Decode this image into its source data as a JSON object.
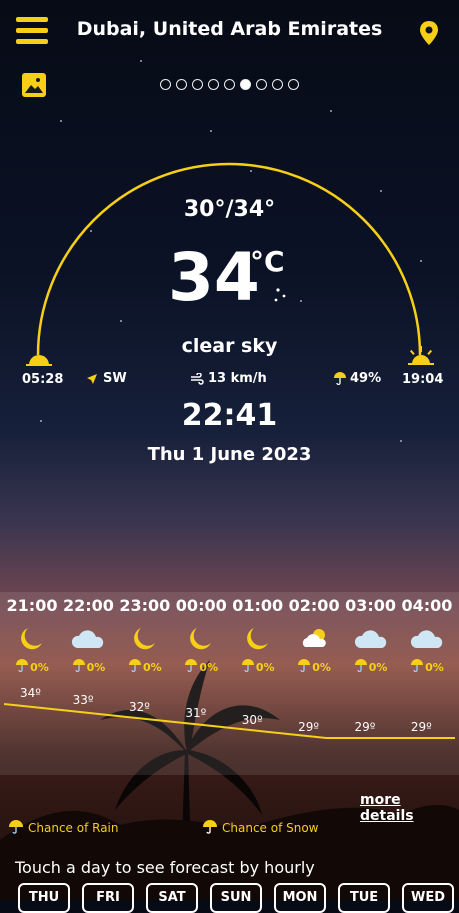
{
  "header": {
    "location": "Dubai, United Arab Emirates"
  },
  "pager": {
    "count": 9,
    "active_index": 5
  },
  "current": {
    "min_max": "30°/34°",
    "temperature": "34",
    "unit": "°C",
    "condition": "clear sky",
    "sunrise": "05:28",
    "sunset": "19:04",
    "wind_direction": "SW",
    "wind_speed": "13 km/h",
    "rain_chance": "49%",
    "time": "22:41",
    "date": "Thu 1 June 2023"
  },
  "hourly": [
    {
      "time": "21:00",
      "icon": "moon-icon",
      "rain": "0%",
      "temp": "34º"
    },
    {
      "time": "22:00",
      "icon": "cloud-icon",
      "rain": "0%",
      "temp": "33º"
    },
    {
      "time": "23:00",
      "icon": "moon-icon",
      "rain": "0%",
      "temp": "32º"
    },
    {
      "time": "00:00",
      "icon": "moon-icon",
      "rain": "0%",
      "temp": "31º"
    },
    {
      "time": "01:00",
      "icon": "moon-icon",
      "rain": "0%",
      "temp": "30º"
    },
    {
      "time": "02:00",
      "icon": "partly-cloudy-icon",
      "rain": "0%",
      "temp": "29º"
    },
    {
      "time": "03:00",
      "icon": "cloud-icon",
      "rain": "0%",
      "temp": "29º"
    },
    {
      "time": "04:00",
      "icon": "cloud-icon",
      "rain": "0%",
      "temp": "29º"
    }
  ],
  "more_details": "more details",
  "legend": {
    "rain": "Chance of Rain",
    "snow": "Chance of Snow"
  },
  "touch_hint": "Touch a day to see forecast by hourly",
  "days": [
    "THU",
    "FRI",
    "SAT",
    "SUN",
    "MON",
    "TUE",
    "WED"
  ],
  "colors": {
    "accent": "#f6cf16",
    "cloud": "#cfe6f5"
  }
}
